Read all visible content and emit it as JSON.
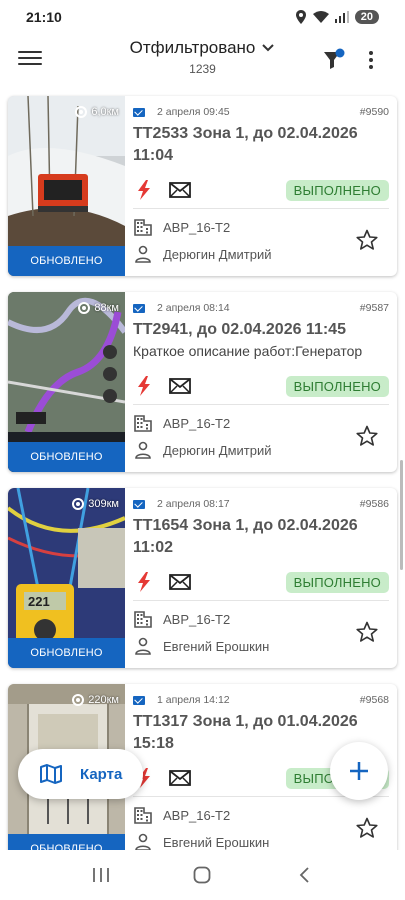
{
  "status_bar": {
    "time": "21:10",
    "battery": "20"
  },
  "app_bar": {
    "title": "Отфильтровано",
    "count": "1239"
  },
  "colors": {
    "accent": "#1565c0",
    "status_bg": "#c8ecc9",
    "status_text": "#2e7d32",
    "bolt": "#e53935"
  },
  "tickets": [
    {
      "distance": "6,0км",
      "updated_label": "ОБНОВЛЕНО",
      "date": "2 апреля 09:45",
      "number": "#9590",
      "title": "ТТ2533 Зона 1, до 02.04.2026 11:04",
      "description": "",
      "status": "ВЫПОЛНЕНО",
      "object": "АВР_16-Т2",
      "person": "Дерюгин Дмитрий"
    },
    {
      "distance": "88км",
      "updated_label": "ОБНОВЛЕНО",
      "date": "2 апреля 08:14",
      "number": "#9587",
      "title": "ТТ2941, до 02.04.2026 11:45",
      "description": "Краткое описание работ:Генератор",
      "status": "ВЫПОЛНЕНО",
      "object": "АВР_16-Т2",
      "person": "Дерюгин Дмитрий"
    },
    {
      "distance": "309км",
      "updated_label": "ОБНОВЛЕНО",
      "date": "2 апреля 08:17",
      "number": "#9586",
      "title": "ТТ1654 Зона 1, до 02.04.2026 11:02",
      "description": "",
      "status": "ВЫПОЛНЕНО",
      "object": "АВР_16-Т2",
      "person": "Евгений Ерошкин"
    },
    {
      "distance": "220км",
      "updated_label": "ОБНОВЛЕНО",
      "date": "1 апреля 14:12",
      "number": "#9568",
      "title": "ТТ1317 Зона 1, до 01.04.2026 15:18",
      "description": "",
      "status": "ВЫПОЛНЕНО",
      "object": "АВР_16-Т2",
      "person": "Евгений Ерошкин"
    }
  ],
  "fab": {
    "map_label": "Карта"
  },
  "icons": {
    "menu": "menu-icon",
    "dropdown": "chevron-down-icon",
    "filter": "filter-icon",
    "more": "more-vert-icon",
    "bolt": "bolt-icon",
    "envelope": "envelope-icon",
    "building": "building-icon",
    "person": "person-icon",
    "star": "star-outline-icon",
    "map": "map-icon",
    "add": "plus-icon"
  }
}
